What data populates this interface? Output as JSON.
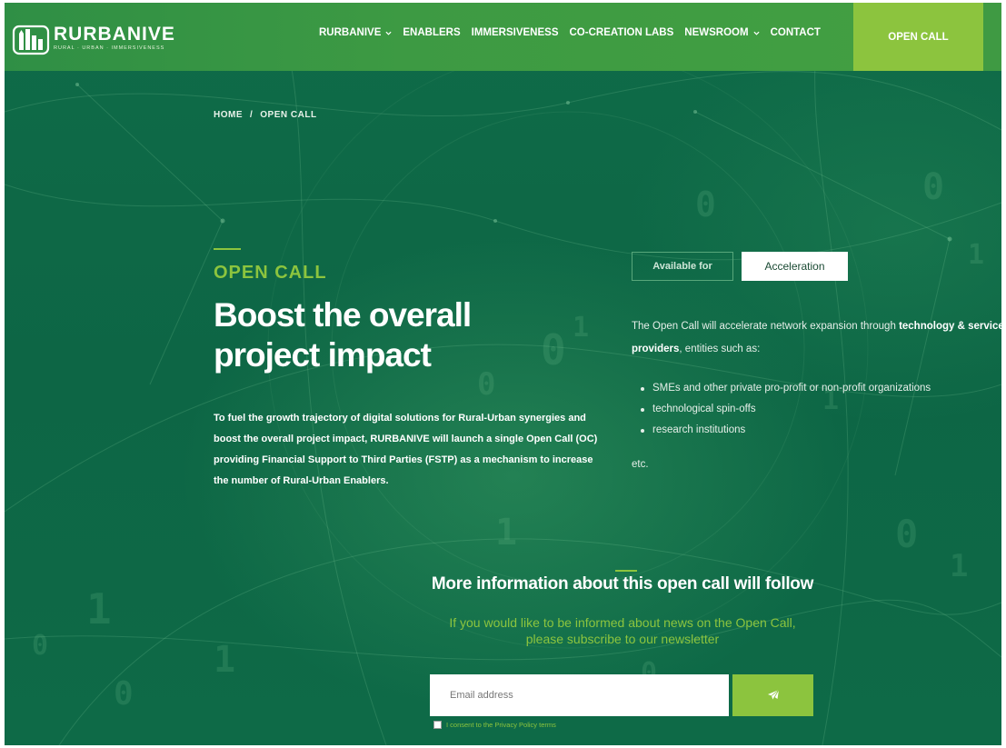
{
  "header": {
    "logo_name": "RURBANIVE",
    "logo_tagline": "RURAL · URBAN · IMMERSIVENESS",
    "nav": [
      {
        "label": "RURBANIVE",
        "has_dropdown": true
      },
      {
        "label": "ENABLERS",
        "has_dropdown": false
      },
      {
        "label": "IMMERSIVENESS",
        "has_dropdown": false
      },
      {
        "label": "CO-CREATION LABS",
        "has_dropdown": false
      },
      {
        "label": "NEWSROOM",
        "has_dropdown": true
      },
      {
        "label": "CONTACT",
        "has_dropdown": false
      }
    ],
    "cta_label": "OPEN CALL"
  },
  "breadcrumb": {
    "home": "HOME",
    "separator": "/",
    "current": "OPEN CALL"
  },
  "hero": {
    "eyebrow": "OPEN CALL",
    "headline": "Boost the overall project impact",
    "intro_parts": {
      "p1": "To fuel the growth trajectory of digital solutions for Rural-Urban synergies and boost the overall project impact, RURBANIVE will launch a single ",
      "b1": "Open Call (OC)",
      "p2": " providing ",
      "b2": "Financial Support to Third Parties (FSTP)",
      "p3": " as a mechanism to increase the number of Rural-Urban Enablers."
    }
  },
  "details": {
    "available_label": "Available for",
    "available_value": "Acceleration",
    "desc_start": "The Open Call will accelerate network expansion through ",
    "desc_bold": "technology & service providers",
    "desc_end": ", entities such as:",
    "entities": [
      "SMEs and other private pro-profit or non-profit organizations",
      "technological spin-offs",
      "research institutions"
    ],
    "etc": "etc."
  },
  "newsletter": {
    "title": "More information about this open call will follow",
    "subtitle_line1": "If you would like to be informed about news on the Open Call,",
    "subtitle_line2": "please subscribe to our newsletter",
    "email_placeholder": "Email address",
    "consent_label": "I consent to the Privacy Policy terms"
  },
  "colors": {
    "background": "#0f6a47",
    "header": "#3d9a43",
    "accent": "#8cc43e",
    "text": "#ffffff"
  },
  "icons": {
    "send": "paper-plane-icon",
    "dropdown": "chevron-down-icon",
    "logo": "city-building-icon"
  }
}
